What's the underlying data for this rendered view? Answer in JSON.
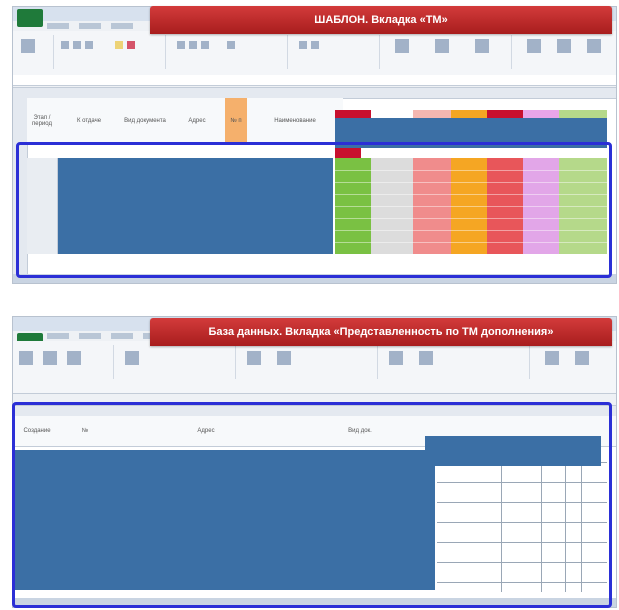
{
  "screens": [
    {
      "banner_title": "ШАБЛОН. Вкладка «ТМ»",
      "header_cells": [
        "Этап / период",
        "К отдаче",
        "Вид документа",
        "Адрес",
        "№ п",
        "Наименование"
      ],
      "status_colors": [
        "#7ac143",
        "#dcdcdc",
        "#f08c8c",
        "#f5a623",
        "#e8565a",
        "#e2a6e8",
        "#b5d98a"
      ],
      "accent_colors": [
        "#c8102e",
        "#e5e5e5",
        "#f5b7b1",
        "#f5a623",
        "#c8102e",
        "#e9a5e9",
        "#b5d98a"
      ]
    },
    {
      "banner_title": "База данных. Вкладка «Представленность по ТМ дополнения»",
      "header_cells": [
        "Создание",
        "№",
        "Адрес",
        "Вид док."
      ],
      "status_colors": [],
      "accent_colors": []
    }
  ],
  "colors": {
    "banner": "#b82424",
    "highlight_border": "#2b2fd6",
    "masked_block": "#3b6fa5"
  }
}
